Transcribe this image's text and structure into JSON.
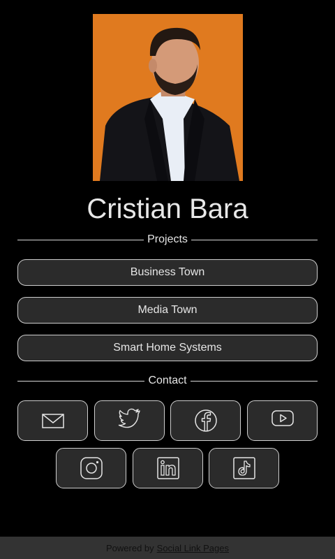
{
  "profile": {
    "name": "Cristian Bara",
    "avatar_bg": "#e07a1f"
  },
  "sections": {
    "projects_label": "Projects",
    "contact_label": "Contact"
  },
  "links": [
    {
      "label": "Business Town"
    },
    {
      "label": "Media Town"
    },
    {
      "label": "Smart Home Systems"
    }
  ],
  "social": [
    {
      "icon": "mail-icon"
    },
    {
      "icon": "twitter-icon"
    },
    {
      "icon": "facebook-icon"
    },
    {
      "icon": "youtube-icon"
    },
    {
      "icon": "instagram-icon"
    },
    {
      "icon": "linkedin-icon"
    },
    {
      "icon": "tiktok-icon"
    }
  ],
  "footer": {
    "prefix": "Powered by",
    "link_label": "Social Link Pages"
  },
  "colors": {
    "background": "#000000",
    "button_bg": "#2b2b2b",
    "border": "#cfcfcf",
    "footer_bg": "#333333"
  }
}
